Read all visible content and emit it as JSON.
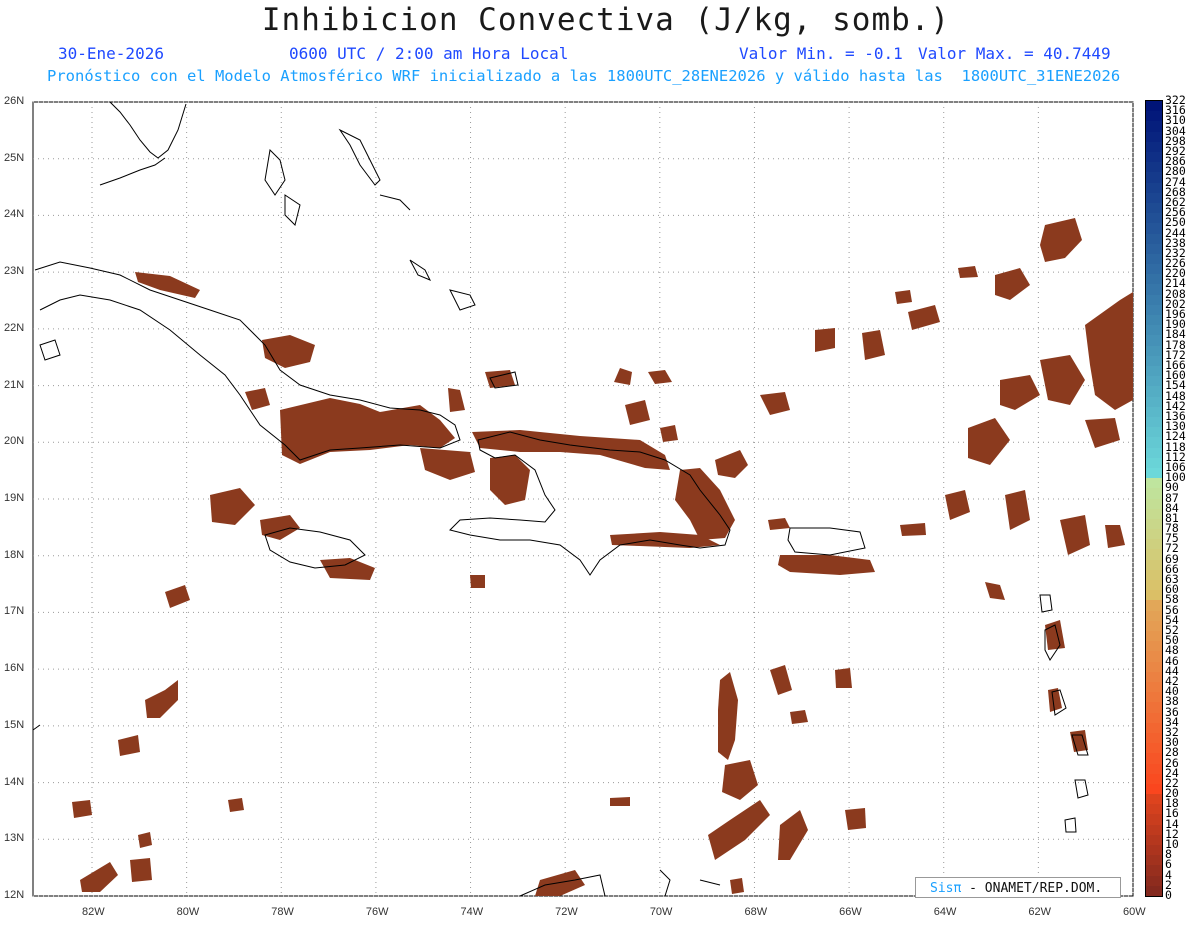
{
  "title": "Inhibicion Convectiva (J/kg, somb.)",
  "date": "30-Ene-2026",
  "time": "0600 UTC / 2:00 am Hora Local",
  "valmin": "Valor Min. = -0.1",
  "valmax": "Valor Max. = 40.7449",
  "subtitle": "Pronóstico con el Modelo Atmosférico WRF inicializado a las 1800UTC_28ENE2026 y válido hasta las  1800UTC_31ENE2026",
  "credit_prefix": "Sisπ",
  "credit_rest": " - ONAMET/REP.DOM.",
  "lat_labels": [
    "26N",
    "25N",
    "24N",
    "23N",
    "22N",
    "21N",
    "20N",
    "19N",
    "18N",
    "17N",
    "16N",
    "15N",
    "14N",
    "13N",
    "12N"
  ],
  "lon_labels": [
    "82W",
    "80W",
    "78W",
    "76W",
    "74W",
    "72W",
    "70W",
    "68W",
    "66W",
    "64W",
    "62W",
    "60W"
  ],
  "colorbar_labels": [
    "322",
    "316",
    "310",
    "304",
    "298",
    "292",
    "286",
    "280",
    "274",
    "268",
    "262",
    "256",
    "250",
    "244",
    "238",
    "232",
    "226",
    "220",
    "214",
    "208",
    "202",
    "196",
    "190",
    "184",
    "178",
    "172",
    "166",
    "160",
    "154",
    "148",
    "142",
    "136",
    "130",
    "124",
    "118",
    "112",
    "106",
    "100",
    "90",
    "87",
    "84",
    "81",
    "78",
    "75",
    "72",
    "69",
    "66",
    "63",
    "60",
    "58",
    "56",
    "54",
    "52",
    "50",
    "48",
    "46",
    "44",
    "42",
    "40",
    "38",
    "36",
    "34",
    "32",
    "30",
    "28",
    "26",
    "24",
    "22",
    "20",
    "18",
    "16",
    "14",
    "12",
    "10",
    "8",
    "6",
    "4",
    "2",
    "0"
  ],
  "colors": {
    "field": "#8b3a1e",
    "field_light": "#b4552d",
    "coast": "#000000",
    "grid": "#9a9a9a"
  }
}
